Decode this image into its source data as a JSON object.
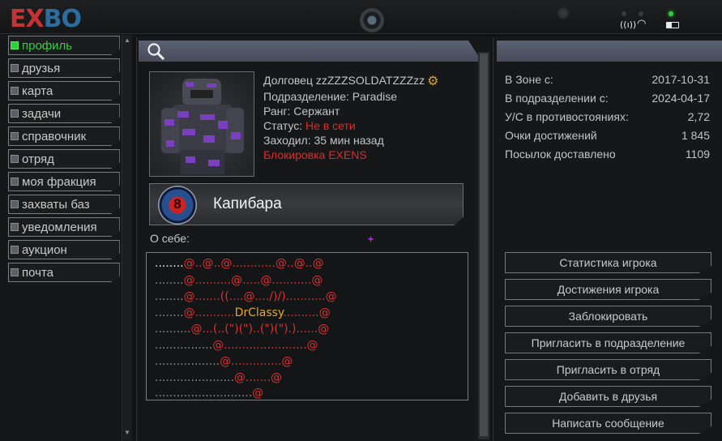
{
  "logo": {
    "part1": "EX",
    "part2": "BO"
  },
  "sidebar": {
    "items": [
      {
        "label": "профиль",
        "active": true
      },
      {
        "label": "друзья"
      },
      {
        "label": "карта"
      },
      {
        "label": "задачи"
      },
      {
        "label": "справочник"
      },
      {
        "label": "отряд"
      },
      {
        "label": "моя фракция"
      },
      {
        "label": "захваты баз"
      },
      {
        "label": "уведомления"
      },
      {
        "label": "аукцион"
      },
      {
        "label": "почта"
      }
    ]
  },
  "profile": {
    "name": "Долговец zzZZZSOLDATZZZzz",
    "division": "Подразделение: Paradise",
    "rank": "Ранг: Сержант",
    "status_label": "Статус:",
    "status_value": "Не в сети",
    "last_seen": "Заходил: 35 мин назад",
    "ban": "Блокировка EXENS"
  },
  "clan": {
    "emblem_text": "8",
    "name": "Капибара"
  },
  "about": {
    "label": "О себе:",
    "lines": [
      {
        "dots": "........",
        "text": "@..@..@............@..@..@"
      },
      {
        "dots": "........",
        "text": "@..........@.....@...........@"
      },
      {
        "dots": "........",
        "text": "@.......((....@..../)/)...........@"
      },
      {
        "dots": "........",
        "text": "@...........",
        "highlight": "DrClassy",
        "text2": "..........@"
      },
      {
        "dots": "..........",
        "text": "@...(..(\")(\")..(\")(\").)......@"
      },
      {
        "dots": "................",
        "text": "@.......................@"
      },
      {
        "dots": "..................",
        "text": "@..............@"
      },
      {
        "dots": "......................",
        "text": "@.......@"
      },
      {
        "dots": "...........................",
        "text": "@"
      }
    ]
  },
  "stats": [
    {
      "label": "В Зоне с:",
      "value": "2017-10-31"
    },
    {
      "label": "В подразделении с:",
      "value": "2024-04-17"
    },
    {
      "label": "У/С в противостояниях:",
      "value": "2,72"
    },
    {
      "label": "Очки достижений",
      "value": "1 845"
    },
    {
      "label": "Посылок доставлено",
      "value": "1109"
    }
  ],
  "actions": {
    "stats": "Статистика игрока",
    "achievements": "Достижения игрока",
    "block": "Заблокировать",
    "invite_division": "Пригласить в подразделение",
    "invite_squad": "Пригласить в отряд",
    "add_friend": "Добавить в друзья",
    "message": "Написать сообщение"
  },
  "colors": {
    "accent_green": "#31d13e",
    "alert_red": "#e02a2a",
    "highlight": "#e6a819",
    "header_blue": "#545868"
  }
}
